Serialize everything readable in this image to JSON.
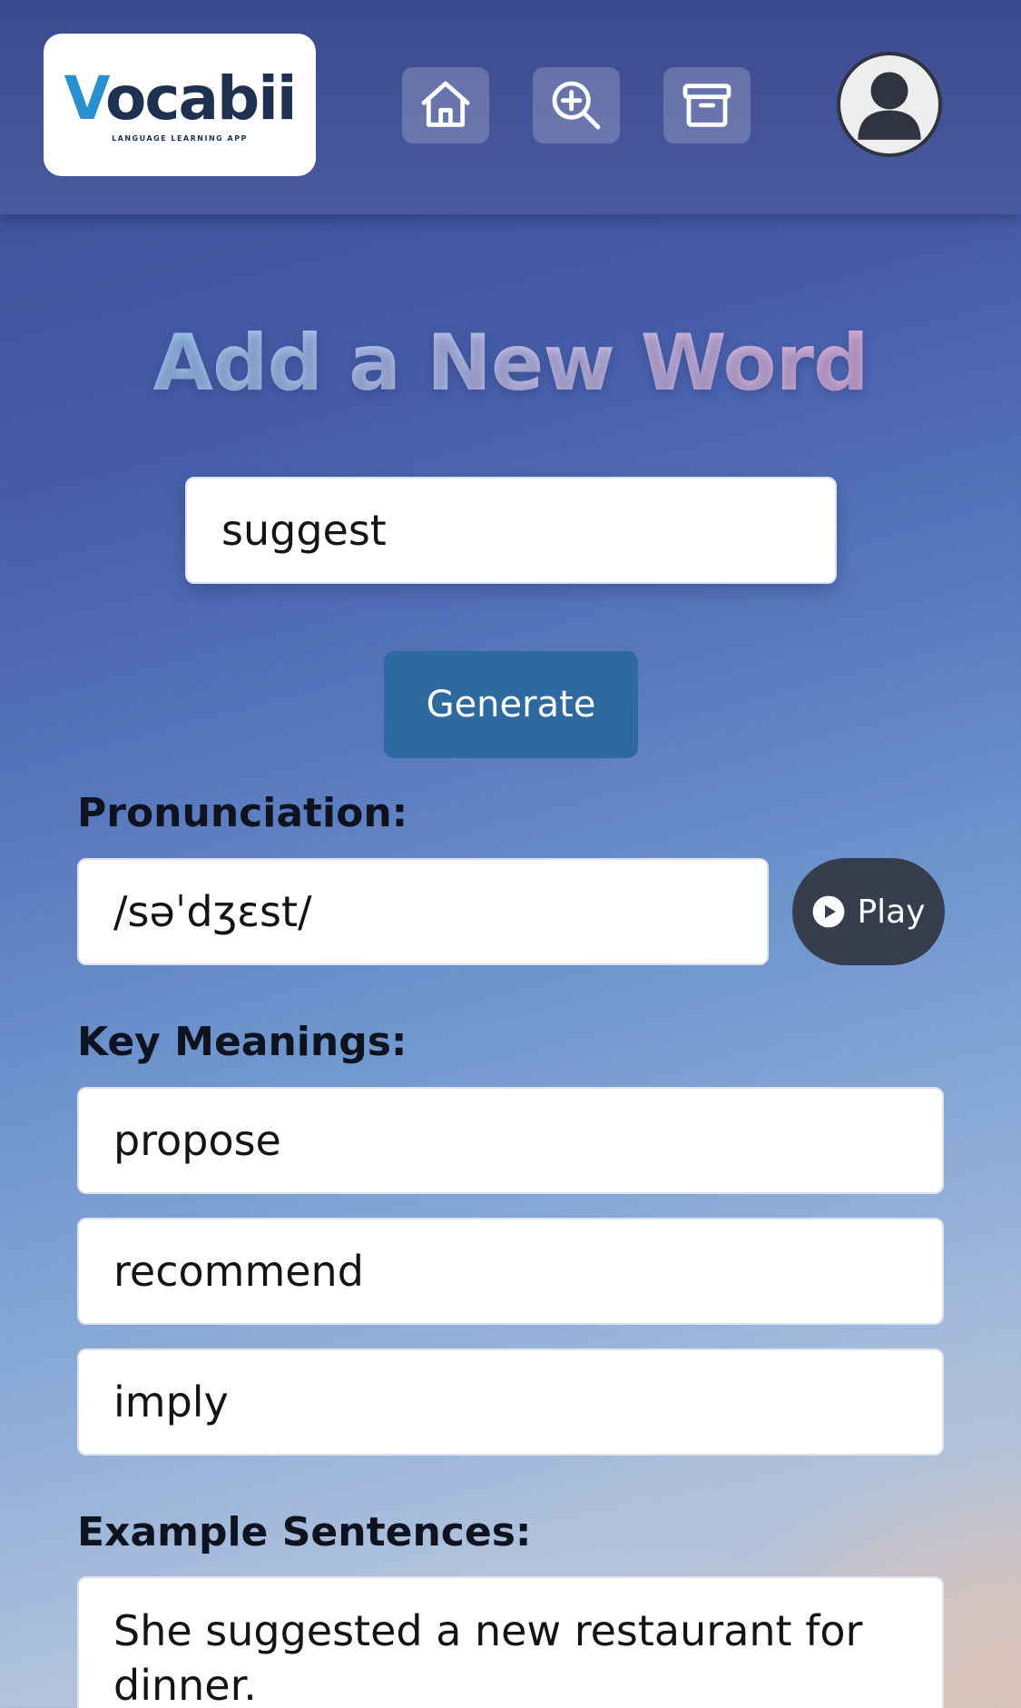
{
  "header": {
    "logo": {
      "word_prefix": "V",
      "word_rest": "ocabii",
      "tagline": "LANGUAGE LEARNING APP"
    },
    "nav": [
      {
        "icon": "home-icon"
      },
      {
        "icon": "search-plus-icon"
      },
      {
        "icon": "archive-icon"
      }
    ],
    "avatar_icon": "user-icon"
  },
  "main": {
    "title": "Add a New Word",
    "word_input_value": "suggest",
    "generate_label": "Generate",
    "pronunciation_label": "Pronunciation:",
    "pronunciation_value": "/səˈdʒɛst/",
    "play_label": "Play",
    "meanings_label": "Key Meanings:",
    "meanings": [
      "propose",
      "recommend",
      "imply"
    ],
    "examples_label": "Example Sentences:",
    "examples": [
      "She suggested a new restaurant for dinner."
    ]
  },
  "colors": {
    "accent": "#2e6aa0",
    "play_button": "#363d4d",
    "title_gradient_start": "#8ec6f0",
    "title_gradient_end": "#e6a8d2"
  }
}
